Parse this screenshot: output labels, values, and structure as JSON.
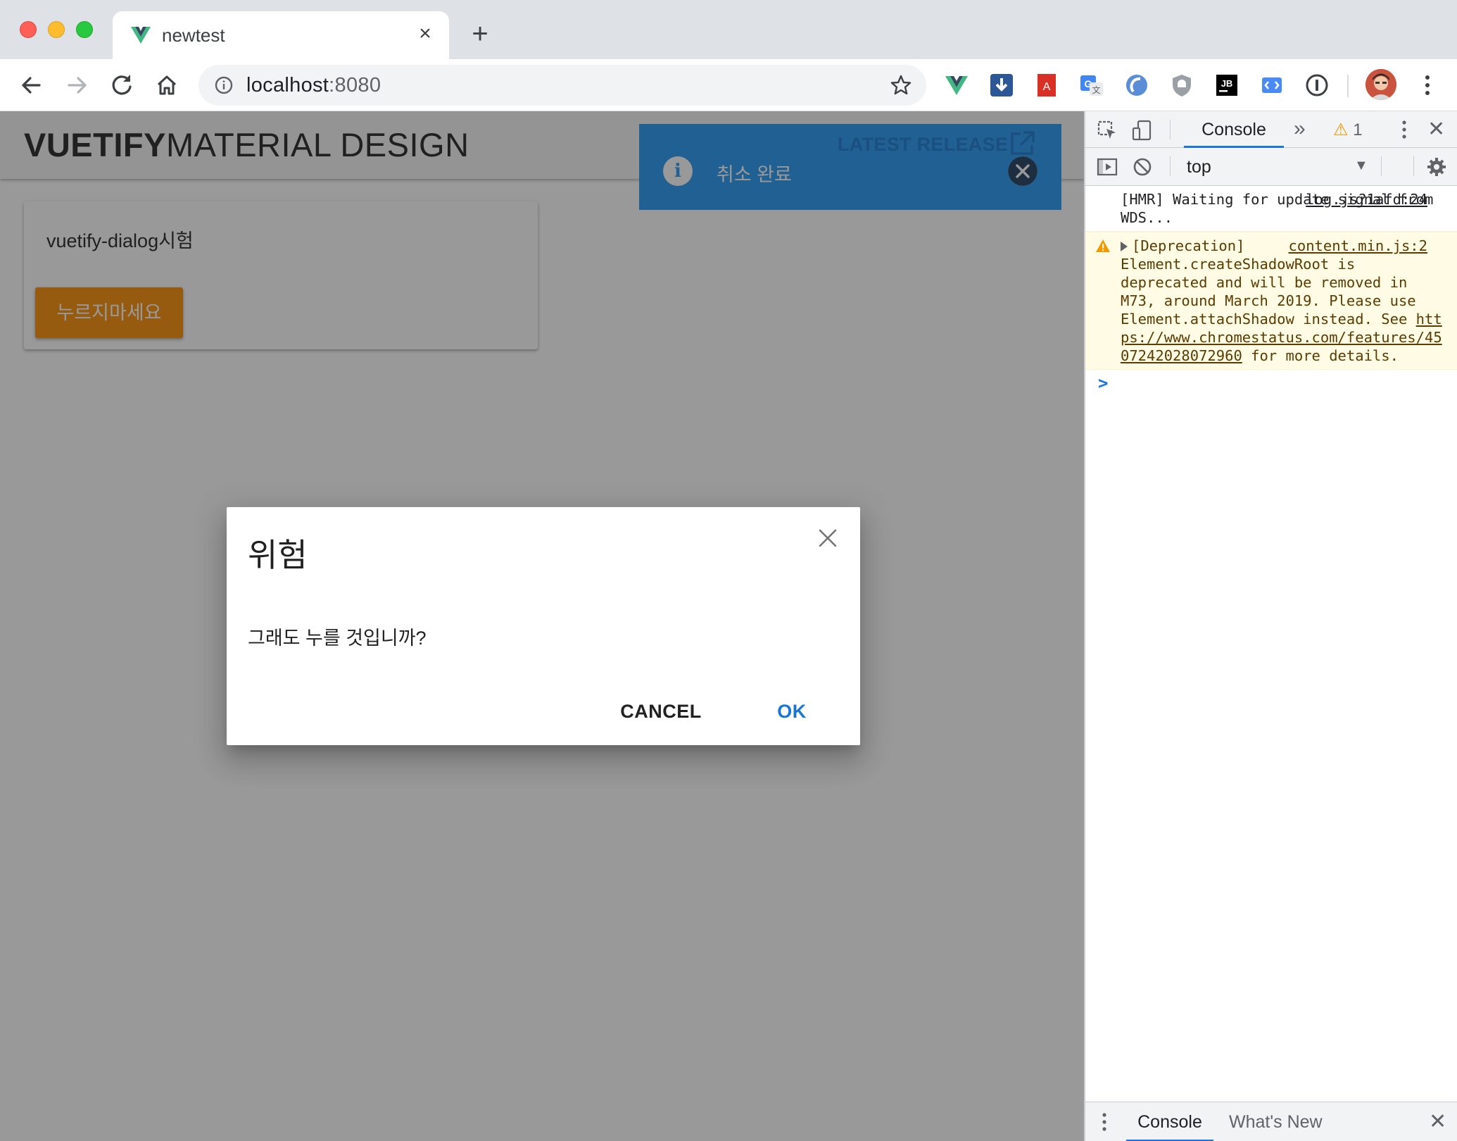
{
  "browser": {
    "tab": {
      "title": "newtest",
      "favicon": "vue-icon",
      "close_icon": "close-icon"
    },
    "new_tab_icon": "plus-icon",
    "nav": {
      "back_icon": "arrow-left-icon",
      "forward_icon": "arrow-right-icon",
      "reload_icon": "reload-icon",
      "home_icon": "home-icon"
    },
    "url": {
      "host": "localhost",
      "port": ":8080"
    },
    "bookmark_icon": "star-icon",
    "extensions": [
      "vue-devtools-icon",
      "download-icon",
      "pdf-icon",
      "google-translate-icon",
      "circle-ext-icon",
      "shield-ext-icon",
      "jetbrains-icon",
      "code-ext-icon",
      "1password-icon"
    ],
    "profile_icon": "avatar"
  },
  "page": {
    "app_bar": {
      "title_bold": "VUETIFY",
      "title_thin": "MATERIAL DESIGN"
    },
    "latest_release": {
      "label": "LATEST RELEASE",
      "icon": "open-in-new-icon"
    },
    "alert": {
      "text": "취소 완료",
      "icon": "info-icon",
      "close_icon": "close-circle-icon",
      "color": "#2196f3"
    },
    "card": {
      "text": "vuetify-dialog시험",
      "button_label": "누르지마세요",
      "button_color": "#fb8c00"
    },
    "dialog": {
      "title": "위험",
      "message": "그래도 누를 것입니까?",
      "cancel_label": "CANCEL",
      "ok_label": "OK",
      "accent": "#1976d2"
    }
  },
  "devtools": {
    "tabs": {
      "active": "Console",
      "more": "»"
    },
    "warning_count": "1",
    "context": "top",
    "console": {
      "hmr": {
        "text": "[HMR] Waiting for update signal from WDS...",
        "source": "log.js?1afd:24"
      },
      "deprecation": {
        "prefix": "[Deprecation]",
        "source": "content.min.js:2",
        "body": "Element.createShadowRoot is deprecated and will be removed in M73, around March 2019. Please use Element.attachShadow instead. See ",
        "link": "https://www.chromestatus.com/features/4507242028072960",
        "suffix": " for more details."
      },
      "prompt": ">"
    },
    "drawer": {
      "tab_active": "Console",
      "tab_inactive": "What's New"
    }
  }
}
